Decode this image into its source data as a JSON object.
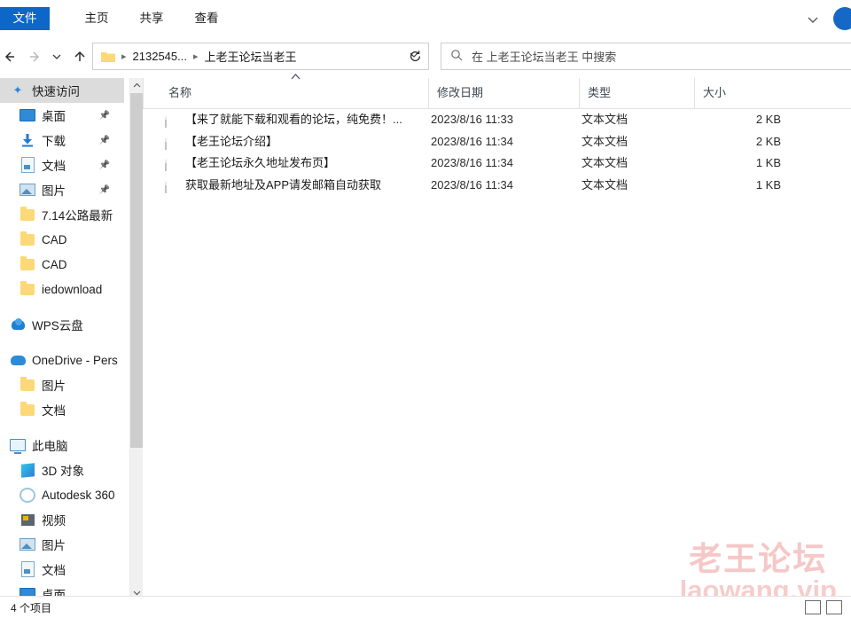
{
  "window": {
    "ribbon_tabs": [
      {
        "label": "文件",
        "active": true
      },
      {
        "label": "主页",
        "active": false
      },
      {
        "label": "共享",
        "active": false
      },
      {
        "label": "查看",
        "active": false
      }
    ],
    "ribbon_expand_icon": "chevron-down-icon"
  },
  "navbar": {
    "back_icon": "arrow-left-icon",
    "forward_icon": "arrow-right-icon",
    "recent_icon": "chevron-down-icon",
    "up_icon": "arrow-up-icon",
    "refresh_icon": "refresh-icon",
    "breadcrumbs": [
      "2132545...",
      "上老王论坛当老王"
    ],
    "dropdown_icon": "chevron-down-icon"
  },
  "search": {
    "icon": "search-icon",
    "placeholder": "在 上老王论坛当老王 中搜索"
  },
  "sidebar": {
    "items": [
      {
        "label": "快速访问",
        "icon": "pin-star-icon",
        "level": 0,
        "selected": true,
        "pinned": false
      },
      {
        "label": "桌面",
        "icon": "desktop-icon",
        "level": 1,
        "selected": false,
        "pinned": true
      },
      {
        "label": "下载",
        "icon": "download-icon",
        "level": 1,
        "selected": false,
        "pinned": true
      },
      {
        "label": "文档",
        "icon": "document-icon",
        "level": 1,
        "selected": false,
        "pinned": true
      },
      {
        "label": "图片",
        "icon": "pictures-icon",
        "level": 1,
        "selected": false,
        "pinned": true
      },
      {
        "label": "7.14公路最新",
        "icon": "folder-icon",
        "level": 1,
        "selected": false,
        "pinned": false
      },
      {
        "label": "CAD",
        "icon": "folder-icon",
        "level": 1,
        "selected": false,
        "pinned": false
      },
      {
        "label": "CAD",
        "icon": "folder-icon",
        "level": 1,
        "selected": false,
        "pinned": false
      },
      {
        "label": "iedownload",
        "icon": "folder-icon",
        "level": 1,
        "selected": false,
        "pinned": false
      },
      {
        "label": "WPS云盘",
        "icon": "wps-cloud-icon",
        "level": 0,
        "selected": false,
        "pinned": false,
        "gap_before": true
      },
      {
        "label": "OneDrive - Pers",
        "icon": "onedrive-icon",
        "level": 0,
        "selected": false,
        "pinned": false,
        "gap_before": true
      },
      {
        "label": "图片",
        "icon": "folder-icon",
        "level": 1,
        "selected": false,
        "pinned": false
      },
      {
        "label": "文档",
        "icon": "folder-icon",
        "level": 1,
        "selected": false,
        "pinned": false
      },
      {
        "label": "此电脑",
        "icon": "this-pc-icon",
        "level": 0,
        "selected": false,
        "pinned": false,
        "gap_before": true
      },
      {
        "label": "3D 对象",
        "icon": "3d-objects-icon",
        "level": 1,
        "selected": false,
        "pinned": false
      },
      {
        "label": "Autodesk 360",
        "icon": "autodesk-icon",
        "level": 1,
        "selected": false,
        "pinned": false
      },
      {
        "label": "视频",
        "icon": "videos-icon",
        "level": 1,
        "selected": false,
        "pinned": false
      },
      {
        "label": "图片",
        "icon": "pictures-icon",
        "level": 1,
        "selected": false,
        "pinned": false
      },
      {
        "label": "文档",
        "icon": "document-icon",
        "level": 1,
        "selected": false,
        "pinned": false
      },
      {
        "label": "桌面",
        "icon": "desktop-icon",
        "level": 1,
        "selected": false,
        "pinned": false
      }
    ],
    "scroll_up_icon": "chevron-up-icon",
    "scroll_down_icon": "chevron-down-icon"
  },
  "filelist": {
    "columns": {
      "name": "名称",
      "date": "修改日期",
      "type": "类型",
      "size": "大小"
    },
    "sort_indicator": "sort-ascending-caret",
    "rows": [
      {
        "name": "【来了就能下载和观看的论坛，纯免费！...",
        "date": "2023/8/16 11:33",
        "type": "文本文档",
        "size": "2 KB",
        "icon": "text-file-icon"
      },
      {
        "name": "【老王论坛介绍】",
        "date": "2023/8/16 11:34",
        "type": "文本文档",
        "size": "2 KB",
        "icon": "text-file-icon"
      },
      {
        "name": "【老王论坛永久地址发布页】",
        "date": "2023/8/16 11:34",
        "type": "文本文档",
        "size": "1 KB",
        "icon": "text-file-icon"
      },
      {
        "name": "获取最新地址及APP请发邮箱自动获取",
        "date": "2023/8/16 11:34",
        "type": "文本文档",
        "size": "1 KB",
        "icon": "text-file-icon"
      }
    ]
  },
  "statusbar": {
    "item_count": "4 个项目",
    "view_list_icon": "details-view-icon",
    "view_tiles_icon": "large-icons-view-icon"
  },
  "watermark": {
    "line1": "老王论坛",
    "line2": "laowang.vip",
    "color": "#f6c7c7"
  }
}
